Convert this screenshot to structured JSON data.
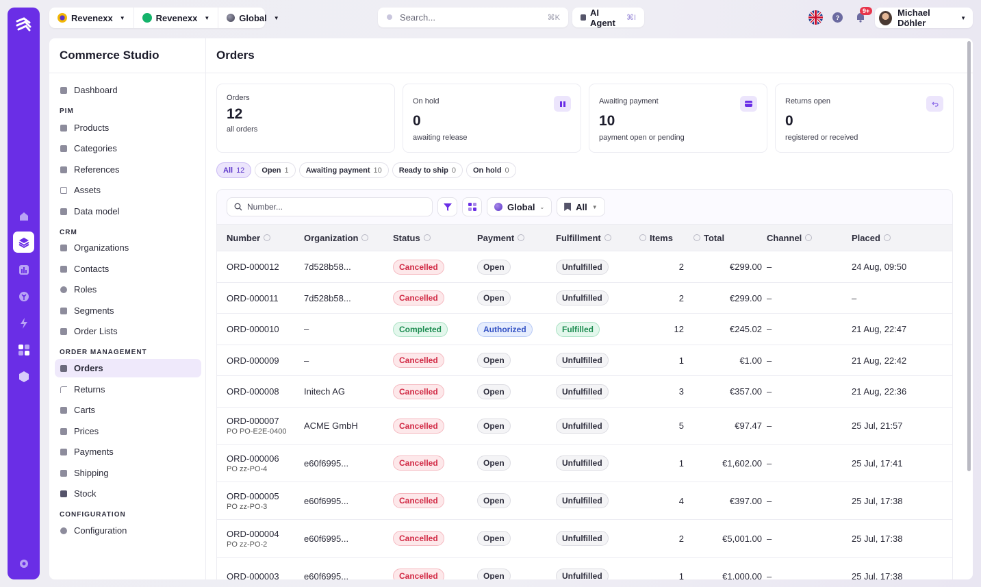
{
  "topbar": {
    "contexts": [
      {
        "label": "Revenexx",
        "icon": "brand-coin-icon",
        "color": "#f2b705"
      },
      {
        "label": "Revenexx",
        "icon": "green-dot-icon",
        "color": "#14b36b"
      },
      {
        "label": "Global",
        "icon": "globe-icon",
        "color": "#555566"
      }
    ],
    "search_placeholder": "Search...",
    "search_shortcut": "⌘K",
    "ai_agent_label": "AI Agent",
    "ai_agent_shortcut": "⌘I",
    "notifications_badge": "9+",
    "user_name": "Michael Döhler"
  },
  "sidebar": {
    "title": "Commerce Studio",
    "dashboard": "Dashboard",
    "sections": [
      {
        "heading": "PIM",
        "items": [
          "Products",
          "Categories",
          "References",
          "Assets",
          "Data model"
        ]
      },
      {
        "heading": "CRM",
        "items": [
          "Organizations",
          "Contacts",
          "Roles",
          "Segments",
          "Order Lists"
        ]
      },
      {
        "heading": "ORDER MANAGEMENT",
        "items": [
          "Orders",
          "Returns",
          "Carts",
          "Prices",
          "Payments",
          "Shipping",
          "Stock"
        ]
      },
      {
        "heading": "CONFIGURATION",
        "items": [
          "Configuration"
        ]
      }
    ],
    "active_item": "Orders"
  },
  "main": {
    "title": "Orders",
    "cards": [
      {
        "label": "Orders",
        "value": "12",
        "sub": "all orders",
        "icon": ""
      },
      {
        "label": "On hold",
        "value": "0",
        "sub": "awaiting release",
        "icon": "pause-icon"
      },
      {
        "label": "Awaiting payment",
        "value": "10",
        "sub": "payment open or pending",
        "icon": "wallet-icon"
      },
      {
        "label": "Returns open",
        "value": "0",
        "sub": "registered or received",
        "icon": "return-arrow-icon"
      }
    ],
    "status_tabs": [
      {
        "label": "All",
        "count": "12",
        "active": true
      },
      {
        "label": "Open",
        "count": "1",
        "active": false
      },
      {
        "label": "Awaiting payment",
        "count": "10",
        "active": false
      },
      {
        "label": "Ready to ship",
        "count": "0",
        "active": false
      },
      {
        "label": "On hold",
        "count": "0",
        "active": false
      }
    ],
    "filter": {
      "number_placeholder": "Number...",
      "scope_select": "Global",
      "list_select": "All"
    },
    "columns": [
      "Number",
      "Organization",
      "Status",
      "Payment",
      "Fulfillment",
      "Items",
      "Total",
      "Channel",
      "Placed"
    ],
    "orders": [
      {
        "number": "ORD-000012",
        "po": "",
        "organization": "7d528b58...",
        "status": "Cancelled",
        "payment": "Open",
        "fulfillment": "Unfulfilled",
        "items": "2",
        "total": "€299.00",
        "channel": "–",
        "placed": "24 Aug, 09:50"
      },
      {
        "number": "ORD-000011",
        "po": "",
        "organization": "7d528b58...",
        "status": "Cancelled",
        "payment": "Open",
        "fulfillment": "Unfulfilled",
        "items": "2",
        "total": "€299.00",
        "channel": "–",
        "placed": "–"
      },
      {
        "number": "ORD-000010",
        "po": "",
        "organization": "–",
        "status": "Completed",
        "payment": "Authorized",
        "fulfillment": "Fulfilled",
        "items": "12",
        "total": "€245.02",
        "channel": "–",
        "placed": "21 Aug, 22:47"
      },
      {
        "number": "ORD-000009",
        "po": "",
        "organization": "–",
        "status": "Cancelled",
        "payment": "Open",
        "fulfillment": "Unfulfilled",
        "items": "1",
        "total": "€1.00",
        "channel": "–",
        "placed": "21 Aug, 22:42"
      },
      {
        "number": "ORD-000008",
        "po": "",
        "organization": "Initech AG",
        "status": "Cancelled",
        "payment": "Open",
        "fulfillment": "Unfulfilled",
        "items": "3",
        "total": "€357.00",
        "channel": "–",
        "placed": "21 Aug, 22:36"
      },
      {
        "number": "ORD-000007",
        "po": "PO PO-E2E-0400",
        "organization": "ACME GmbH",
        "status": "Cancelled",
        "payment": "Open",
        "fulfillment": "Unfulfilled",
        "items": "5",
        "total": "€97.47",
        "channel": "–",
        "placed": "25 Jul, 21:57"
      },
      {
        "number": "ORD-000006",
        "po": "PO zz-PO-4",
        "organization": "e60f6995...",
        "status": "Cancelled",
        "payment": "Open",
        "fulfillment": "Unfulfilled",
        "items": "1",
        "total": "€1,602.00",
        "channel": "–",
        "placed": "25 Jul, 17:41"
      },
      {
        "number": "ORD-000005",
        "po": "PO zz-PO-3",
        "organization": "e60f6995...",
        "status": "Cancelled",
        "payment": "Open",
        "fulfillment": "Unfulfilled",
        "items": "4",
        "total": "€397.00",
        "channel": "–",
        "placed": "25 Jul, 17:38"
      },
      {
        "number": "ORD-000004",
        "po": "PO zz-PO-2",
        "organization": "e60f6995...",
        "status": "Cancelled",
        "payment": "Open",
        "fulfillment": "Unfulfilled",
        "items": "2",
        "total": "€5,001.00",
        "channel": "–",
        "placed": "25 Jul, 17:38"
      },
      {
        "number": "ORD-000003",
        "po": "",
        "organization": "e60f6995...",
        "status": "Cancelled",
        "payment": "Open",
        "fulfillment": "Unfulfilled",
        "items": "1",
        "total": "€1,000.00",
        "channel": "–",
        "placed": "25 Jul, 17:38"
      }
    ]
  },
  "colors": {
    "accent": "#6a2ee6",
    "cancelled": "#d12a45",
    "completed": "#1d8c51",
    "authorized": "#3452c4"
  }
}
